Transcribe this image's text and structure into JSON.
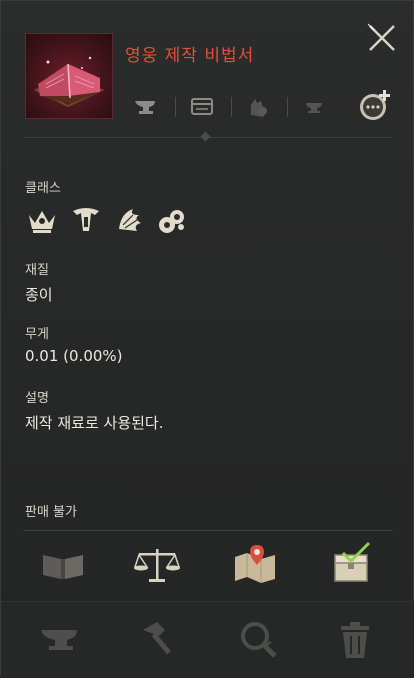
{
  "item": {
    "name": "영웅 제작 비법서",
    "name_color": "#e0503a",
    "image": "recipe-book-icon"
  },
  "toolbar": {
    "icons": [
      "anvil-icon",
      "storage-chest-icon",
      "hand-bag-icon",
      "anvil-small-icon",
      "chat-add-icon"
    ]
  },
  "class": {
    "label": "클래스",
    "icons": [
      "crown-class-icon",
      "warrior-class-icon",
      "wing-class-icon",
      "orb-class-icon"
    ]
  },
  "material": {
    "label": "재질",
    "value": "종이"
  },
  "weight": {
    "label": "무게",
    "value": "0.01 (0.00%)"
  },
  "description": {
    "label": "설명",
    "value": "제작 재료로 사용된다."
  },
  "sale": {
    "label": "판매 불가"
  },
  "actions": [
    "open-book-icon",
    "scales-icon",
    "map-pin-icon",
    "checked-chest-icon"
  ],
  "bottom": [
    "anvil-icon",
    "hammer-icon",
    "magnifier-icon",
    "trash-icon"
  ]
}
